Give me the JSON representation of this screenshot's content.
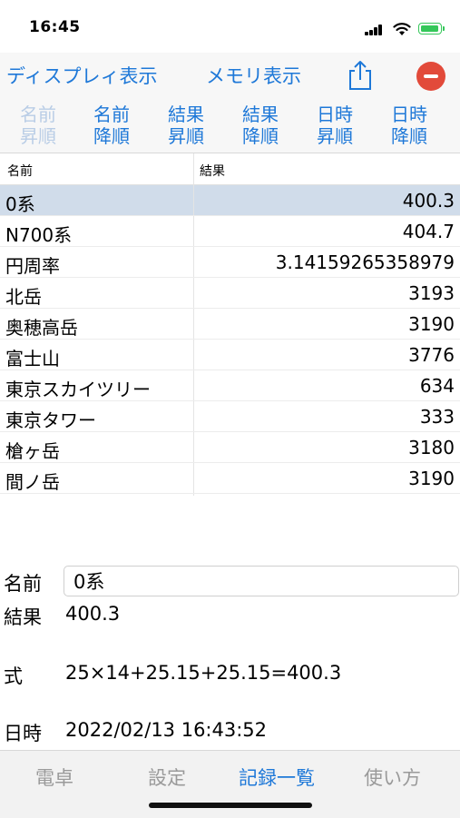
{
  "status": {
    "time": "16:45"
  },
  "toolbar": {
    "display_label": "ディスプレィ表示",
    "memory_label": "メモリ表示",
    "share_icon": "share-icon",
    "delete_icon": "minus-circle-icon"
  },
  "sort_buttons": [
    {
      "line1": "名前",
      "line2": "昇順",
      "enabled": false
    },
    {
      "line1": "名前",
      "line2": "降順",
      "enabled": true
    },
    {
      "line1": "結果",
      "line2": "昇順",
      "enabled": true
    },
    {
      "line1": "結果",
      "line2": "降順",
      "enabled": true
    },
    {
      "line1": "日時",
      "line2": "昇順",
      "enabled": true
    },
    {
      "line1": "日時",
      "line2": "降順",
      "enabled": true
    }
  ],
  "table": {
    "headers": {
      "name": "名前",
      "result": "結果"
    },
    "rows": [
      {
        "name": "0系",
        "value": "400.3",
        "selected": true
      },
      {
        "name": "N700系",
        "value": "404.7",
        "selected": false
      },
      {
        "name": "円周率",
        "value": "3.14159265358979",
        "selected": false
      },
      {
        "name": "北岳",
        "value": "3193",
        "selected": false
      },
      {
        "name": "奥穂高岳",
        "value": "3190",
        "selected": false
      },
      {
        "name": "富士山",
        "value": "3776",
        "selected": false
      },
      {
        "name": "東京スカイツリー",
        "value": "634",
        "selected": false
      },
      {
        "name": "東京タワー",
        "value": "333",
        "selected": false
      },
      {
        "name": "槍ヶ岳",
        "value": "3180",
        "selected": false
      },
      {
        "name": "間ノ岳",
        "value": "3190",
        "selected": false
      }
    ]
  },
  "details": {
    "name_label": "名前",
    "name_value": "0系",
    "result_label": "結果",
    "result_value": "400.3",
    "formula_label": "式",
    "formula_value": "25×14+25.15+25.15=400.3",
    "date_label": "日時",
    "date_value": "2022/02/13 16:43:52"
  },
  "tabs": [
    {
      "label": "電卓",
      "active": false
    },
    {
      "label": "設定",
      "active": false
    },
    {
      "label": "記録一覧",
      "active": true
    },
    {
      "label": "使い方",
      "active": false
    }
  ],
  "colors": {
    "accent": "#1e78d8",
    "selected_row": "#d0dcea",
    "delete": "#e24a3a",
    "battery": "#34c759"
  }
}
